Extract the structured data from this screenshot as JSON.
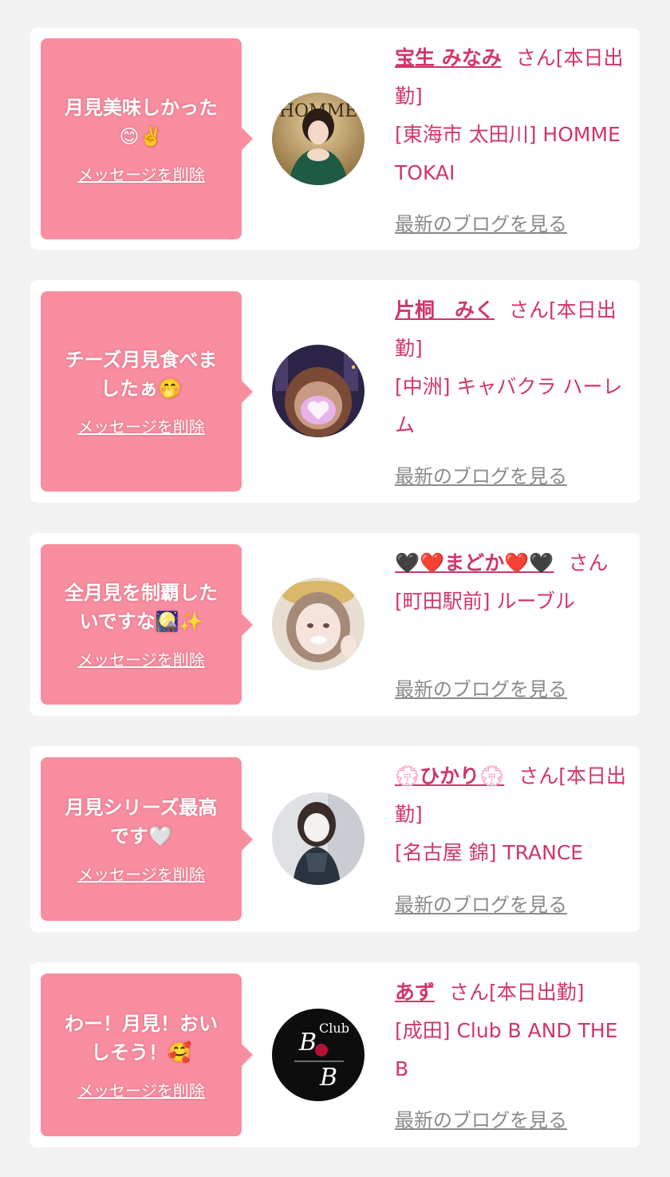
{
  "cards": [
    {
      "message": "月見美味しかった\n😊✌️",
      "delete_label": "メッセージを削除",
      "name": "宝生 みなみ",
      "suffix": "さん[本日出勤]",
      "shop": "[東海市 太田川] HOMME TOKAI",
      "blog_label": "最新のブログを見る",
      "avatar_text": "HOMME"
    },
    {
      "message": "チーズ月見食べま\nしたぁ🤭",
      "delete_label": "メッセージを削除",
      "name": "片桐　みく",
      "suffix": "さん[本日出勤]",
      "shop": "[中洲] キャバクラ ハーレム",
      "blog_label": "最新のブログを見る"
    },
    {
      "message": "全月見を制覇した\nいですな🎑✨",
      "delete_label": "メッセージを削除",
      "name": "🖤❤️まどか❤️🖤",
      "suffix": "さん",
      "shop": "[町田駅前] ルーブル",
      "blog_label": "最新のブログを見る"
    },
    {
      "message": "月見シリーズ最高\nです🤍",
      "delete_label": "メッセージを削除",
      "name": "💮ひかり💮",
      "suffix": "さん[本日出勤]",
      "shop": "[名古屋 錦] TRANCE",
      "blog_label": "最新のブログを見る"
    },
    {
      "message": "わー！月見！おい\nしそう！🥰",
      "delete_label": "メッセージを削除",
      "name": "あず",
      "suffix": "さん[本日出勤]",
      "shop": "[成田] Club B AND THE B",
      "blog_label": "最新のブログを見る",
      "avatar_text": "Club"
    }
  ]
}
